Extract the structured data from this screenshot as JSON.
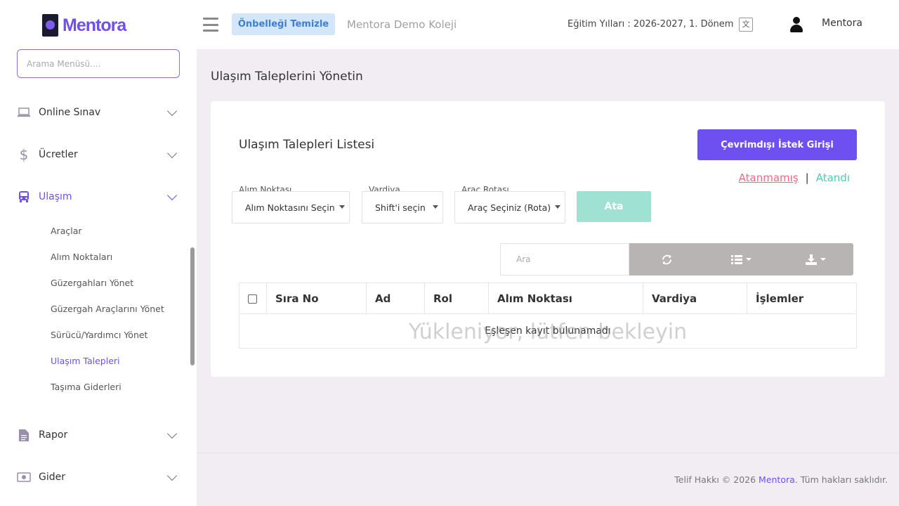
{
  "brand": {
    "name": "Mentora"
  },
  "sidebar": {
    "search_placeholder": "Arama Menüsü....",
    "items": [
      {
        "label": "Online Sınav",
        "icon": "laptop-icon"
      },
      {
        "label": "Ücretler",
        "icon": "dollar-icon"
      },
      {
        "label": "Ulaşım",
        "icon": "bus-icon",
        "active": true
      },
      {
        "label": "Rapor",
        "icon": "document-icon"
      },
      {
        "label": "Gider",
        "icon": "money-icon"
      }
    ],
    "sub_items": [
      {
        "label": "Araçlar"
      },
      {
        "label": "Alım Noktaları"
      },
      {
        "label": "Güzergahları Yönet"
      },
      {
        "label": "Güzergah Araçlarını Yönet"
      },
      {
        "label": "Sürücü/Yardımcı Yönet"
      },
      {
        "label": "Ulaşım Talepleri",
        "active": true
      },
      {
        "label": "Taşıma Giderleri"
      }
    ]
  },
  "header": {
    "cache_button": "Önbelleği Temizle",
    "school_name": "Mentora Demo Koleji",
    "education_years": "Eğitim Yılları : 2026-2027, 1. Dönem",
    "user_name": "Mentora"
  },
  "main": {
    "page_title": "Ulaşım Taleplerini Yönetin",
    "card_title": "Ulaşım Talepleri Listesi",
    "offline_button": "Çevrimdışı İstek Girişi",
    "status_unassigned": "Atanmamış",
    "status_separator": "|",
    "status_assigned": "Atandı",
    "filters": {
      "pickup_label": "Alım Noktası",
      "pickup_value": "Alım Noktasını Seçin",
      "shift_label": "Vardiya",
      "shift_value": "Shift'i seçin",
      "route_label": "Araç Rotası",
      "route_value": "Araç Seçiniz (Rota)"
    },
    "assign_button": "Ata",
    "table_search_placeholder": "Ara",
    "table": {
      "columns": [
        "Sıra No",
        "Ad",
        "Rol",
        "Alım Noktası",
        "Vardiya",
        "İşlemler"
      ],
      "empty_message": "Eşleşen kayıt bulunamadı",
      "loading_message": "Yükleniyor, lütfen bekleyin"
    }
  },
  "footer": {
    "prefix": "Telif Hakkı © 2026 ",
    "brand": "Mentora",
    "suffix": ". Tüm hakları saklıdır."
  },
  "colors": {
    "accent": "#6e4ff0",
    "unassigned": "#f06a7f",
    "assigned": "#4ccdb2",
    "assign_button": "#9fe2d3"
  }
}
